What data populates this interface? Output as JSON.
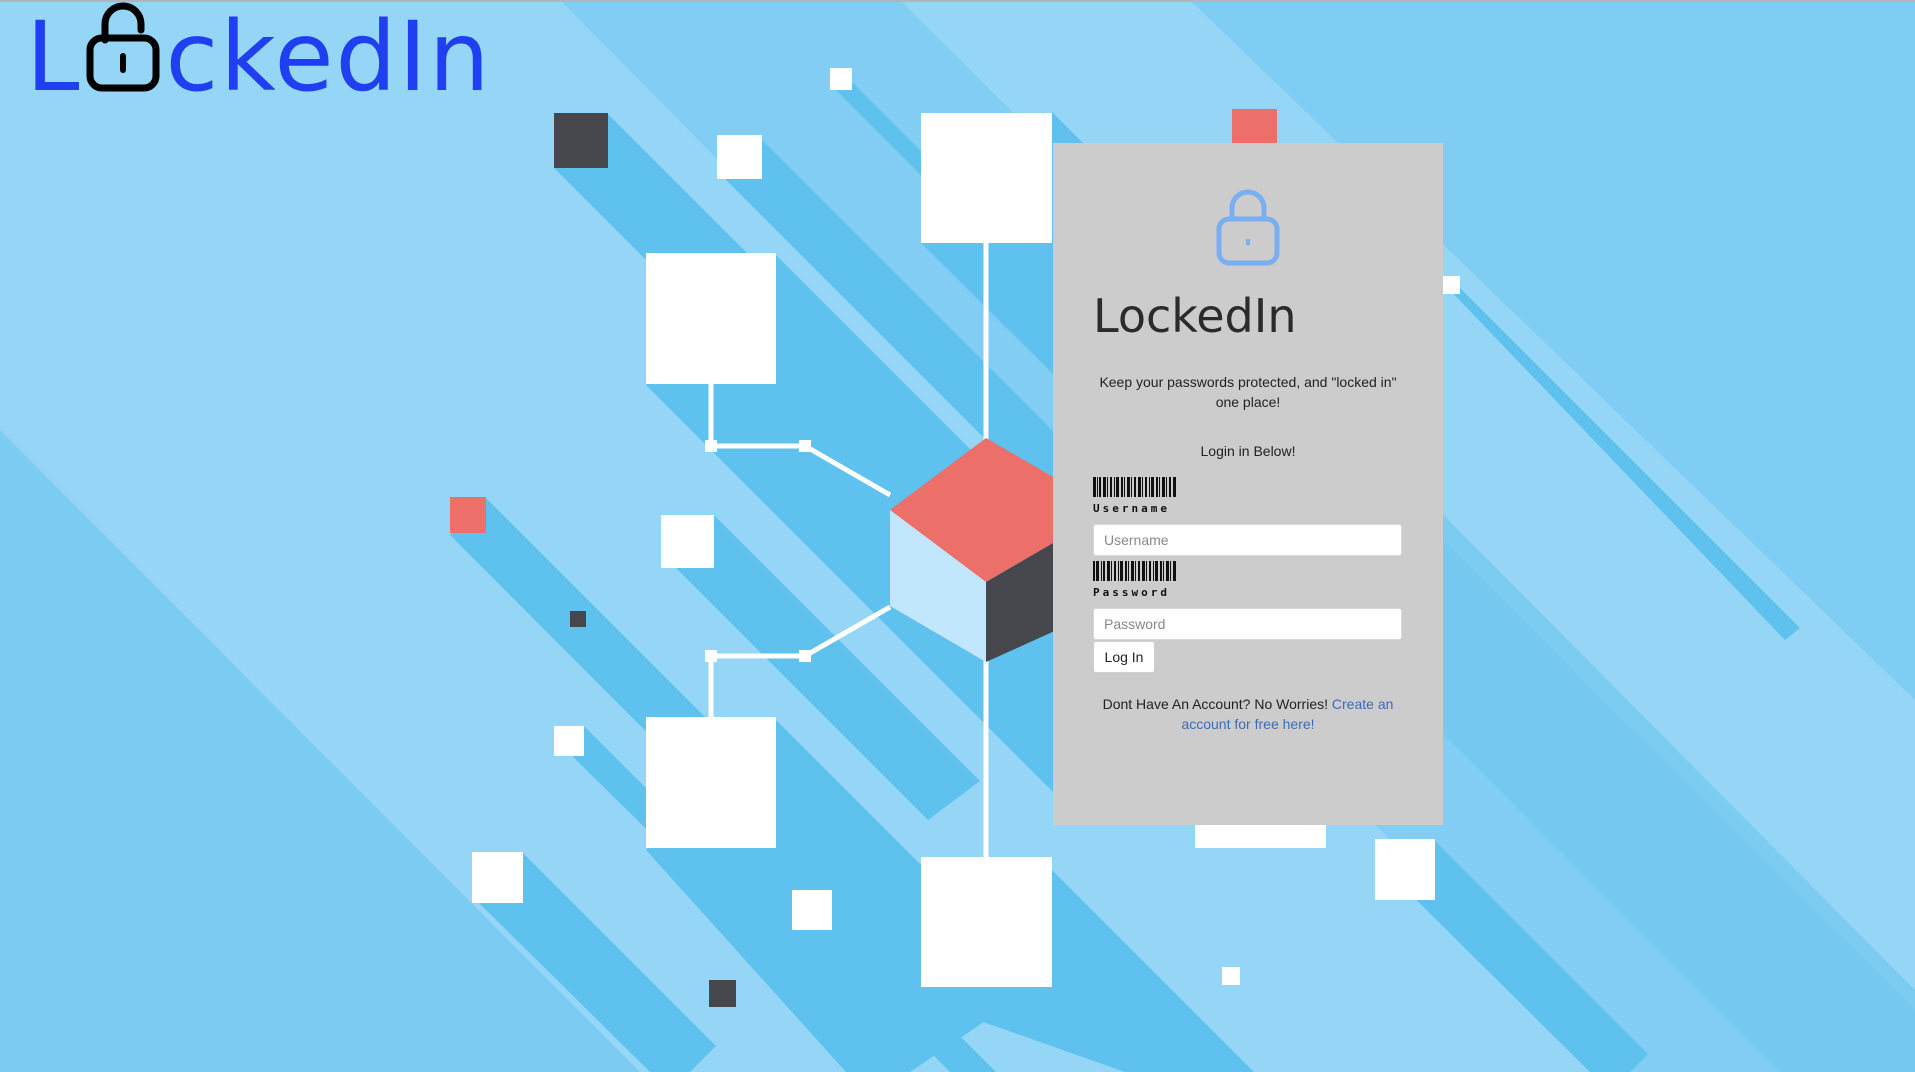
{
  "logo": {
    "prefix": "L",
    "suffix": "ckedIn",
    "lock_icon": "padlock-icon",
    "color": "#1f3ff0"
  },
  "login": {
    "lock_icon": "padlock-icon",
    "title": "LockedIn",
    "tagline": "Keep your passwords protected, and \"locked in\" one place!",
    "heading": "Login in Below!",
    "username_label": "Username",
    "username_placeholder": "Username",
    "password_label": "Password",
    "password_placeholder": "Password",
    "button_label": "Log In",
    "signup_prompt": "Dont Have An Account? No Worries!",
    "signup_link": "Create an account for free here!",
    "card_color": "#cccccc",
    "link_color": "#3a6fb5"
  },
  "colors": {
    "background": "#8fd3f6",
    "accent_red": "#ec7069",
    "dark_block": "#45474d"
  }
}
